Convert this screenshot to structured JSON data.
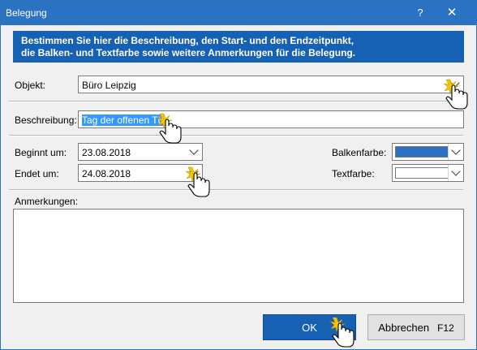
{
  "window": {
    "title": "Belegung",
    "help": "?",
    "close": "✕"
  },
  "banner": {
    "line1": "Bestimmen Sie hier die Beschreibung, den Start- und den Endzeitpunkt,",
    "line2": "die Balken- und Textfarbe sowie weitere Anmerkungen für die Belegung."
  },
  "form": {
    "objekt_label": "Objekt:",
    "objekt_value": "Büro Leipzig",
    "beschreibung_label": "Beschreibung:",
    "beschreibung_value": "Tag der offenen Tü",
    "beginnt_label": "Beginnt um:",
    "beginnt_value": "23.08.2018",
    "endet_label": "Endet um:",
    "endet_value": "24.08.2018",
    "balkenfarbe_label": "Balkenfarbe:",
    "textfarbe_label": "Textfarbe:",
    "anmerkungen_label": "Anmerkungen:"
  },
  "colors": {
    "balkenfarbe": "#2b73c2",
    "textfarbe": "#ffffff",
    "accent": "#1761b4"
  },
  "buttons": {
    "ok": "OK",
    "cancel": "Abbrechen",
    "cancel_shortcut": "F12"
  },
  "icons": {
    "cursor": "hand-pointer-click-icon"
  }
}
